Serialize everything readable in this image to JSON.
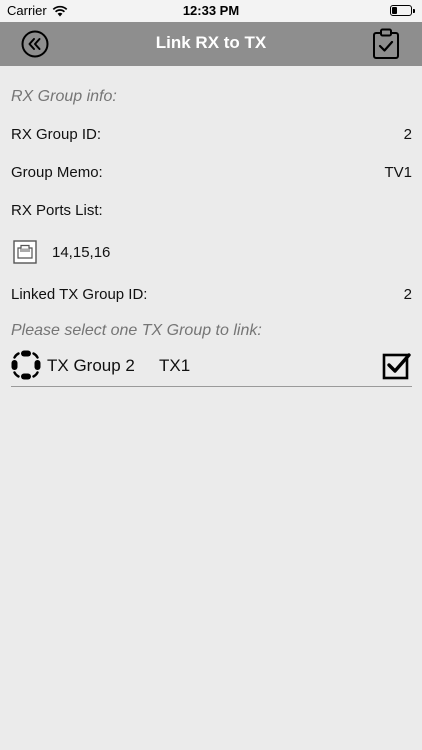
{
  "status_bar": {
    "carrier": "Carrier",
    "time": "12:33 PM",
    "battery_level": 0.25
  },
  "nav": {
    "title": "Link RX to TX",
    "back_icon": "double-chevron-left-circle-icon",
    "right_icon": "clipboard-check-icon"
  },
  "rx_group": {
    "section_title": "RX Group info:",
    "id_label": "RX Group ID:",
    "id_value": "2",
    "memo_label": "Group Memo:",
    "memo_value": "TV1",
    "ports_label": "RX Ports List:",
    "ports_value": "14,15,16",
    "linked_tx_label": "Linked TX Group ID:",
    "linked_tx_value": "2"
  },
  "tx_select": {
    "section_title": "Please select one TX Group to link:",
    "items": [
      {
        "name": "TX Group 2",
        "memo": "TX1",
        "checked": true
      }
    ]
  },
  "colors": {
    "nav_bg": "#8e8e8e",
    "page_bg": "#ebebeb",
    "section_title": "#757575"
  }
}
